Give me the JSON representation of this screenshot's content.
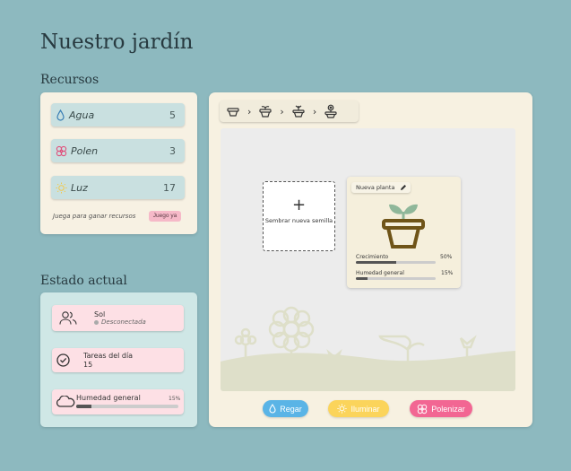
{
  "app": {
    "title": "Nuestro jardín"
  },
  "resources": {
    "title": "Recursos",
    "items": [
      {
        "icon": "water-drop-icon",
        "label": "Agua",
        "count": "5"
      },
      {
        "icon": "flower-icon",
        "label": "Polen",
        "count": "3"
      },
      {
        "icon": "sun-icon",
        "label": "Luz",
        "count": "17"
      }
    ],
    "play_text": "Juega para ganar recursos",
    "play_button": "Juego ya"
  },
  "status": {
    "title": "Estado actual",
    "sun": {
      "name": "Sol",
      "state": "Desconectada"
    },
    "tasks": {
      "label": "Tareas del día",
      "value": "15"
    },
    "humidity": {
      "label": "Humedad general",
      "value": "15%",
      "level": 0.15
    }
  },
  "garden": {
    "stages": [
      "pot-icon",
      "sprout-pot-icon",
      "plant-pot-icon",
      "flower-pot-icon"
    ],
    "sow_label": "Sembrar nueva semilla",
    "plant": {
      "name": "Nueva planta",
      "growth_label": "Crecimiento",
      "growth_value": "50%",
      "growth_level": 0.5,
      "humidity_label": "Humedad general",
      "humidity_value": "15%",
      "humidity_level": 0.15
    },
    "actions": [
      {
        "label": "Regar",
        "icon": "water-drop-icon",
        "color": "#5ab4e6"
      },
      {
        "label": "Iluminar",
        "icon": "sun-icon",
        "color": "#fbd45b"
      },
      {
        "label": "Polenizar",
        "icon": "flower-icon",
        "color": "#f26693"
      }
    ]
  }
}
